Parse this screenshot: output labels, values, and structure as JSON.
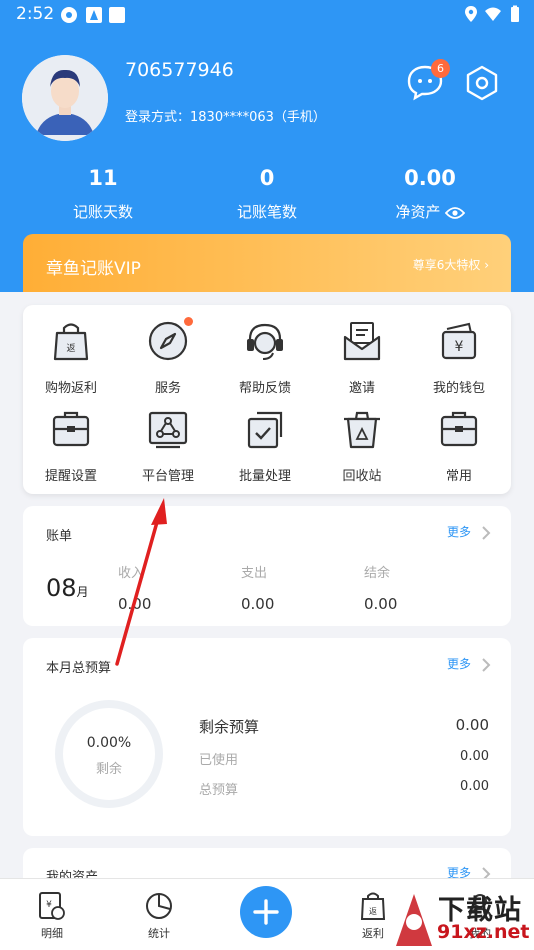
{
  "status_bar": {
    "time": "2:52"
  },
  "profile": {
    "username": "706577946",
    "login_method": "登录方式：1830****063（手机）",
    "message_badge": "6"
  },
  "stats": [
    {
      "value": "11",
      "label": "记账天数"
    },
    {
      "value": "0",
      "label": "记账笔数"
    },
    {
      "value": "0.00",
      "label": "净资产"
    }
  ],
  "vip": {
    "title": "章鱼记账VIP",
    "link": "尊享6大特权"
  },
  "grid": [
    {
      "label": "购物返利",
      "icon": "shopping-bag-icon"
    },
    {
      "label": "服务",
      "icon": "compass-icon",
      "dot": true
    },
    {
      "label": "帮助反馈",
      "icon": "headset-icon"
    },
    {
      "label": "邀请",
      "icon": "envelope-icon"
    },
    {
      "label": "我的钱包",
      "icon": "wallet-icon"
    },
    {
      "label": "提醒设置",
      "icon": "briefcase-icon"
    },
    {
      "label": "平台管理",
      "icon": "platform-icon"
    },
    {
      "label": "批量处理",
      "icon": "batch-icon"
    },
    {
      "label": "回收站",
      "icon": "recycle-bin-icon"
    },
    {
      "label": "常用",
      "icon": "briefcase-icon"
    }
  ],
  "bill": {
    "title": "账单",
    "more": "更多",
    "month": "08",
    "month_unit": "月",
    "columns": [
      {
        "label": "收入",
        "value": "0.00"
      },
      {
        "label": "支出",
        "value": "0.00"
      },
      {
        "label": "结余",
        "value": "0.00"
      }
    ]
  },
  "budget": {
    "title": "本月总预算",
    "more": "更多",
    "percent": "0.00%",
    "ring_label": "剩余",
    "rows": [
      {
        "label": "剩余预算",
        "value": "0.00"
      },
      {
        "label": "已使用",
        "value": "0.00"
      },
      {
        "label": "总预算",
        "value": "0.00"
      }
    ]
  },
  "assets": {
    "title": "我的资产",
    "more": "更多"
  },
  "tabbar": [
    {
      "label": "明细",
      "icon": "ledger-icon"
    },
    {
      "label": "统计",
      "icon": "pie-chart-icon"
    },
    {
      "label": "",
      "icon": "add-icon"
    },
    {
      "label": "返利",
      "icon": "rebate-icon"
    },
    {
      "label": "我的",
      "icon": "profile-icon"
    }
  ],
  "watermark": {
    "line1": "下载站",
    "line2": "91xz.net"
  },
  "colors": {
    "primary": "#2e96f5",
    "vip_start": "#ffae36",
    "vip_end": "#ffd07a",
    "badge": "#ff6a3c",
    "annotation_arrow": "#e02020"
  }
}
